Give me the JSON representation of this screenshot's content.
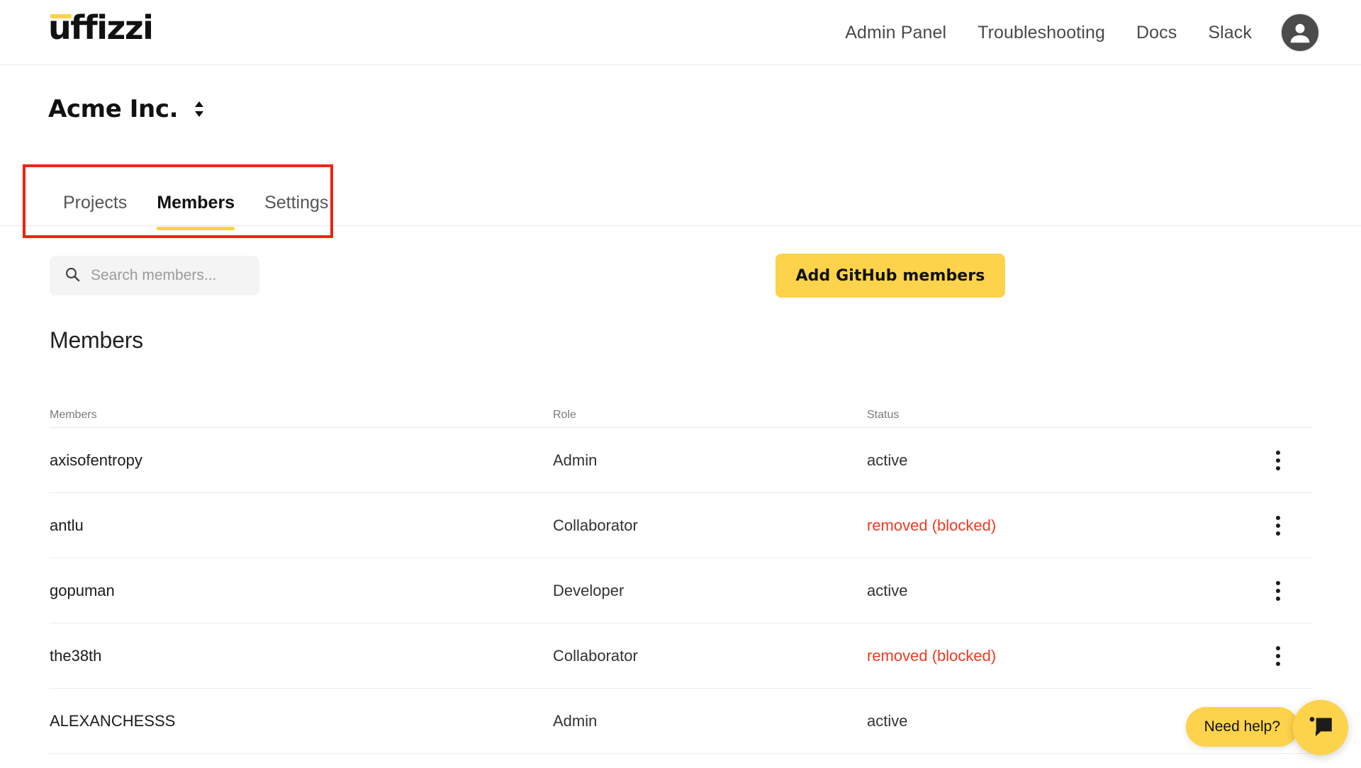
{
  "brand": {
    "logo_text": "uffizzi",
    "accent_color": "#FCD34A"
  },
  "topnav": {
    "links": [
      {
        "label": "Admin Panel"
      },
      {
        "label": "Troubleshooting"
      },
      {
        "label": "Docs"
      },
      {
        "label": "Slack"
      }
    ],
    "avatar_icon": "user-avatar-icon"
  },
  "org": {
    "name": "Acme Inc.",
    "switch_icon": "chevron-up-down-icon"
  },
  "tabs": [
    {
      "label": "Projects",
      "active": false
    },
    {
      "label": "Members",
      "active": true
    },
    {
      "label": "Settings",
      "active": false
    }
  ],
  "toolbar": {
    "search": {
      "icon": "search-icon",
      "value": "",
      "placeholder": "Search members..."
    },
    "add_members_label": "Add GitHub members"
  },
  "section": {
    "title": "Members"
  },
  "table": {
    "columns": [
      "Members",
      "Role",
      "Status"
    ],
    "rows": [
      {
        "member": "axisofentropy",
        "role": "Admin",
        "status": "active",
        "status_danger": false
      },
      {
        "member": "antlu",
        "role": "Collaborator",
        "status": "removed (blocked)",
        "status_danger": true
      },
      {
        "member": "gopuman",
        "role": "Developer",
        "status": "active",
        "status_danger": false
      },
      {
        "member": "the38th",
        "role": "Collaborator",
        "status": "removed (blocked)",
        "status_danger": true
      },
      {
        "member": "ALEXANCHESSS",
        "role": "Admin",
        "status": "active",
        "status_danger": false
      }
    ],
    "row_menu_icon": "kebab-menu-icon"
  },
  "help_widget": {
    "label": "Need help?",
    "chat_icon": "chat-bubble-icon"
  },
  "annotation": {
    "color": "#EE2211",
    "target": "tabs-group"
  }
}
